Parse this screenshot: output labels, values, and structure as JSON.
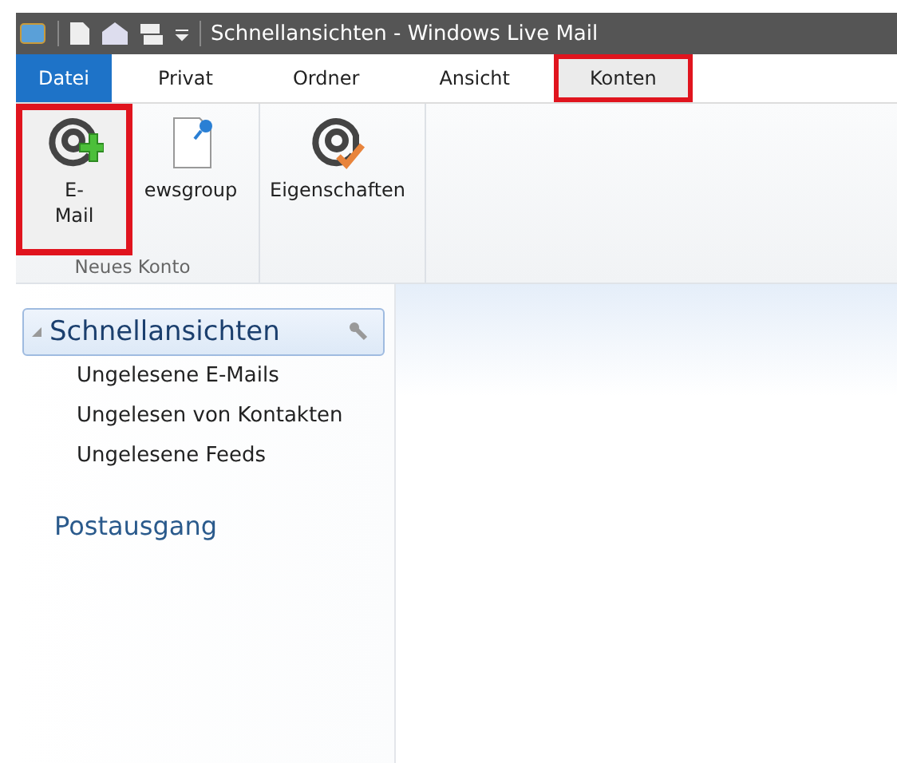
{
  "window": {
    "title": "Schnellansichten - Windows Live Mail"
  },
  "tabs": [
    {
      "label": "Datei",
      "kind": "file",
      "selected": false,
      "highlighted": false
    },
    {
      "label": "Privat",
      "kind": "tab",
      "selected": false,
      "highlighted": false
    },
    {
      "label": "Ordner",
      "kind": "tab",
      "selected": false,
      "highlighted": false
    },
    {
      "label": "Ansicht",
      "kind": "tab",
      "selected": false,
      "highlighted": false
    },
    {
      "label": "Konten",
      "kind": "tab",
      "selected": true,
      "highlighted": true
    }
  ],
  "ribbon_groups": [
    {
      "label": "Neues Konto",
      "buttons": [
        {
          "label": "E-\nMail",
          "kind": "at-plus",
          "highlighted": true
        },
        {
          "label": "ewsgroup",
          "kind": "page-pin",
          "highlighted": false
        }
      ]
    },
    {
      "buttons": [
        {
          "label": "Eigenschaften",
          "kind": "at-check",
          "highlighted": false
        }
      ]
    }
  ],
  "sidebar": {
    "header": {
      "label": "Schnellansichten",
      "expanded": true
    },
    "items": [
      {
        "label": "Ungelesene E-Mails"
      },
      {
        "label": "Ungelesen von Kontakten"
      },
      {
        "label": "Ungelesene Feeds"
      }
    ],
    "folders": [
      {
        "label": "Postausgang"
      }
    ]
  }
}
